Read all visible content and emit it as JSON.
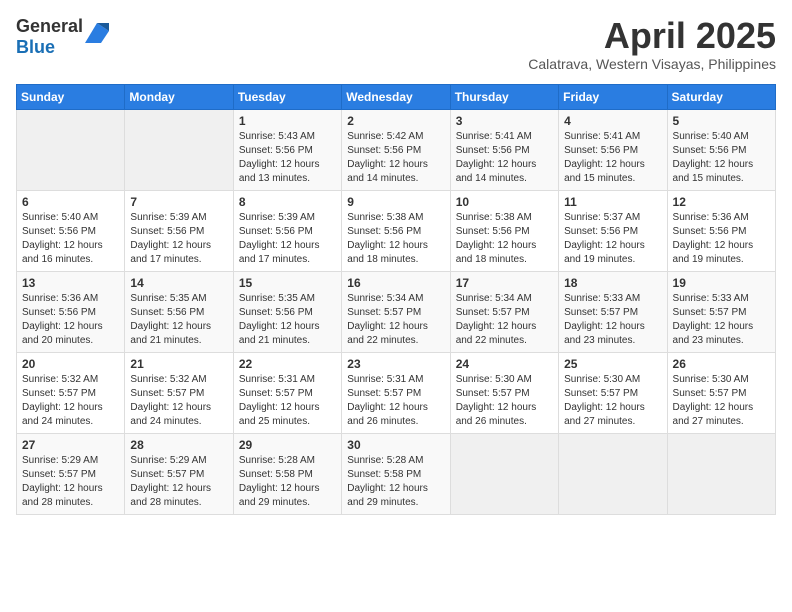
{
  "header": {
    "logo": {
      "general": "General",
      "blue": "Blue"
    },
    "title": "April 2025",
    "subtitle": "Calatrava, Western Visayas, Philippines"
  },
  "calendar": {
    "weekdays": [
      "Sunday",
      "Monday",
      "Tuesday",
      "Wednesday",
      "Thursday",
      "Friday",
      "Saturday"
    ],
    "weeks": [
      [
        {
          "day": "",
          "info": ""
        },
        {
          "day": "",
          "info": ""
        },
        {
          "day": "1",
          "info": "Sunrise: 5:43 AM\nSunset: 5:56 PM\nDaylight: 12 hours\nand 13 minutes."
        },
        {
          "day": "2",
          "info": "Sunrise: 5:42 AM\nSunset: 5:56 PM\nDaylight: 12 hours\nand 14 minutes."
        },
        {
          "day": "3",
          "info": "Sunrise: 5:41 AM\nSunset: 5:56 PM\nDaylight: 12 hours\nand 14 minutes."
        },
        {
          "day": "4",
          "info": "Sunrise: 5:41 AM\nSunset: 5:56 PM\nDaylight: 12 hours\nand 15 minutes."
        },
        {
          "day": "5",
          "info": "Sunrise: 5:40 AM\nSunset: 5:56 PM\nDaylight: 12 hours\nand 15 minutes."
        }
      ],
      [
        {
          "day": "6",
          "info": "Sunrise: 5:40 AM\nSunset: 5:56 PM\nDaylight: 12 hours\nand 16 minutes."
        },
        {
          "day": "7",
          "info": "Sunrise: 5:39 AM\nSunset: 5:56 PM\nDaylight: 12 hours\nand 17 minutes."
        },
        {
          "day": "8",
          "info": "Sunrise: 5:39 AM\nSunset: 5:56 PM\nDaylight: 12 hours\nand 17 minutes."
        },
        {
          "day": "9",
          "info": "Sunrise: 5:38 AM\nSunset: 5:56 PM\nDaylight: 12 hours\nand 18 minutes."
        },
        {
          "day": "10",
          "info": "Sunrise: 5:38 AM\nSunset: 5:56 PM\nDaylight: 12 hours\nand 18 minutes."
        },
        {
          "day": "11",
          "info": "Sunrise: 5:37 AM\nSunset: 5:56 PM\nDaylight: 12 hours\nand 19 minutes."
        },
        {
          "day": "12",
          "info": "Sunrise: 5:36 AM\nSunset: 5:56 PM\nDaylight: 12 hours\nand 19 minutes."
        }
      ],
      [
        {
          "day": "13",
          "info": "Sunrise: 5:36 AM\nSunset: 5:56 PM\nDaylight: 12 hours\nand 20 minutes."
        },
        {
          "day": "14",
          "info": "Sunrise: 5:35 AM\nSunset: 5:56 PM\nDaylight: 12 hours\nand 21 minutes."
        },
        {
          "day": "15",
          "info": "Sunrise: 5:35 AM\nSunset: 5:56 PM\nDaylight: 12 hours\nand 21 minutes."
        },
        {
          "day": "16",
          "info": "Sunrise: 5:34 AM\nSunset: 5:57 PM\nDaylight: 12 hours\nand 22 minutes."
        },
        {
          "day": "17",
          "info": "Sunrise: 5:34 AM\nSunset: 5:57 PM\nDaylight: 12 hours\nand 22 minutes."
        },
        {
          "day": "18",
          "info": "Sunrise: 5:33 AM\nSunset: 5:57 PM\nDaylight: 12 hours\nand 23 minutes."
        },
        {
          "day": "19",
          "info": "Sunrise: 5:33 AM\nSunset: 5:57 PM\nDaylight: 12 hours\nand 23 minutes."
        }
      ],
      [
        {
          "day": "20",
          "info": "Sunrise: 5:32 AM\nSunset: 5:57 PM\nDaylight: 12 hours\nand 24 minutes."
        },
        {
          "day": "21",
          "info": "Sunrise: 5:32 AM\nSunset: 5:57 PM\nDaylight: 12 hours\nand 24 minutes."
        },
        {
          "day": "22",
          "info": "Sunrise: 5:31 AM\nSunset: 5:57 PM\nDaylight: 12 hours\nand 25 minutes."
        },
        {
          "day": "23",
          "info": "Sunrise: 5:31 AM\nSunset: 5:57 PM\nDaylight: 12 hours\nand 26 minutes."
        },
        {
          "day": "24",
          "info": "Sunrise: 5:30 AM\nSunset: 5:57 PM\nDaylight: 12 hours\nand 26 minutes."
        },
        {
          "day": "25",
          "info": "Sunrise: 5:30 AM\nSunset: 5:57 PM\nDaylight: 12 hours\nand 27 minutes."
        },
        {
          "day": "26",
          "info": "Sunrise: 5:30 AM\nSunset: 5:57 PM\nDaylight: 12 hours\nand 27 minutes."
        }
      ],
      [
        {
          "day": "27",
          "info": "Sunrise: 5:29 AM\nSunset: 5:57 PM\nDaylight: 12 hours\nand 28 minutes."
        },
        {
          "day": "28",
          "info": "Sunrise: 5:29 AM\nSunset: 5:57 PM\nDaylight: 12 hours\nand 28 minutes."
        },
        {
          "day": "29",
          "info": "Sunrise: 5:28 AM\nSunset: 5:58 PM\nDaylight: 12 hours\nand 29 minutes."
        },
        {
          "day": "30",
          "info": "Sunrise: 5:28 AM\nSunset: 5:58 PM\nDaylight: 12 hours\nand 29 minutes."
        },
        {
          "day": "",
          "info": ""
        },
        {
          "day": "",
          "info": ""
        },
        {
          "day": "",
          "info": ""
        }
      ]
    ]
  }
}
